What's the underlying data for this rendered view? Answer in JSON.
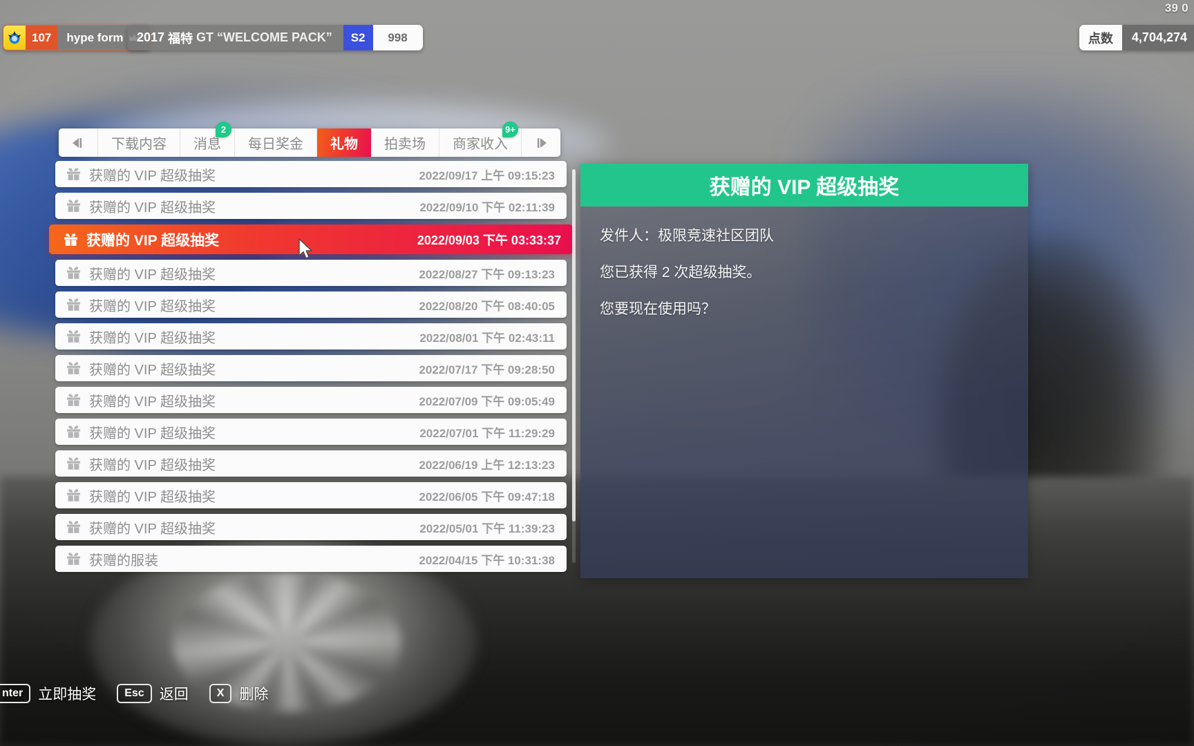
{
  "hud": {
    "corner_value": "39 0",
    "rank": {
      "icon": "hype-wheelspin-icon",
      "number": "107",
      "label": "hype form",
      "crown_icon": "crown-icon"
    },
    "car": {
      "year": "2017",
      "make": "福特",
      "title": "GT “WELCOME PACK”",
      "class": "S2",
      "pi": "998"
    },
    "points": {
      "label": "点数",
      "value": "4,704,274"
    }
  },
  "tabs": {
    "prev_icon": "arrow-left-icon",
    "next_icon": "arrow-right-icon",
    "items": [
      {
        "label": "下载内容",
        "badge": "",
        "active": false
      },
      {
        "label": "消息",
        "badge": "2",
        "active": false
      },
      {
        "label": "每日奖金",
        "badge": "",
        "active": false
      },
      {
        "label": "礼物",
        "badge": "",
        "active": true
      },
      {
        "label": "拍卖场",
        "badge": "",
        "active": false
      },
      {
        "label": "商家收入",
        "badge": "9+",
        "active": false
      }
    ]
  },
  "list": {
    "icon": "gift-icon",
    "rows": [
      {
        "title": "获赠的 VIP 超级抽奖",
        "date": "2022/09/17 上午 09:15:23",
        "selected": false
      },
      {
        "title": "获赠的 VIP 超级抽奖",
        "date": "2022/09/10 下午 02:11:39",
        "selected": false
      },
      {
        "title": "获赠的 VIP 超级抽奖",
        "date": "2022/09/03 下午 03:33:37",
        "selected": true
      },
      {
        "title": "获赠的 VIP 超级抽奖",
        "date": "2022/08/27 下午 09:13:23",
        "selected": false
      },
      {
        "title": "获赠的 VIP 超级抽奖",
        "date": "2022/08/20 下午 08:40:05",
        "selected": false
      },
      {
        "title": "获赠的 VIP 超级抽奖",
        "date": "2022/08/01 下午 02:43:11",
        "selected": false
      },
      {
        "title": "获赠的 VIP 超级抽奖",
        "date": "2022/07/17 下午 09:28:50",
        "selected": false
      },
      {
        "title": "获赠的 VIP 超级抽奖",
        "date": "2022/07/09 下午 09:05:49",
        "selected": false
      },
      {
        "title": "获赠的 VIP 超级抽奖",
        "date": "2022/07/01 下午 11:29:29",
        "selected": false
      },
      {
        "title": "获赠的 VIP 超级抽奖",
        "date": "2022/06/19 上午 12:13:23",
        "selected": false
      },
      {
        "title": "获赠的 VIP 超级抽奖",
        "date": "2022/06/05 下午 09:47:18",
        "selected": false
      },
      {
        "title": "获赠的 VIP 超级抽奖",
        "date": "2022/05/01 下午 11:39:23",
        "selected": false
      },
      {
        "title": "获赠的服装",
        "date": "2022/04/15 下午 10:31:38",
        "selected": false
      }
    ]
  },
  "detail": {
    "title": "获赠的 VIP 超级抽奖",
    "lines": [
      "发件人：极限竞速社区团队",
      "您已获得 2 次超级抽奖。",
      "您要现在使用吗？"
    ]
  },
  "footer": {
    "hints": [
      {
        "key": "nter",
        "label": "立即抽奖",
        "clipped": true
      },
      {
        "key": "Esc",
        "label": "返回",
        "clipped": false
      },
      {
        "key": "X",
        "label": "删除",
        "clipped": false
      }
    ]
  },
  "colors": {
    "accent_red": "#ea0f4e",
    "accent_orange": "#f4671b",
    "badge_green": "#1fc98a",
    "detail_header_green": "#22c68c",
    "class_blue": "#3b50dd"
  }
}
